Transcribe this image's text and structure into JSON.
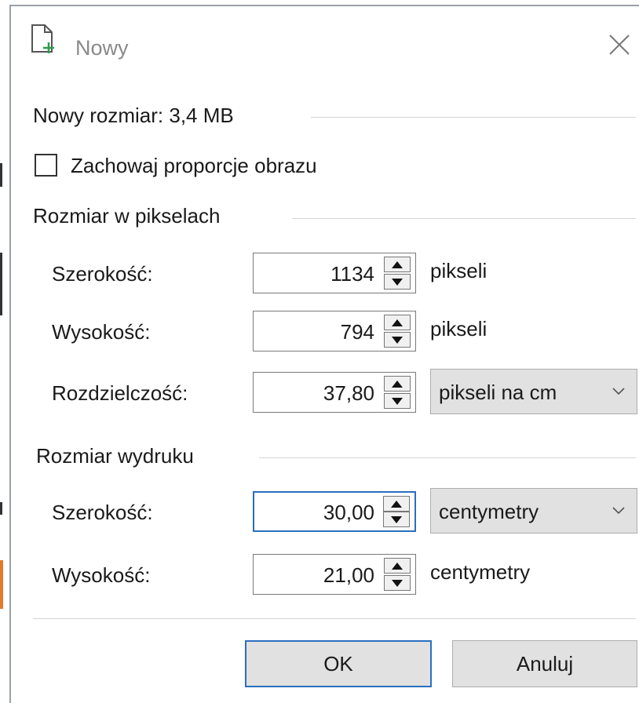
{
  "dialog": {
    "title": "Nowy",
    "new_size_label": "Nowy rozmiar: 3,4 MB",
    "keep_ratio_label": "Zachowaj proporcje obrazu",
    "keep_ratio_checked": false
  },
  "pixel_size": {
    "heading": "Rozmiar w pikselach",
    "width_label": "Szerokość:",
    "width_value": "1134",
    "width_unit": "pikseli",
    "height_label": "Wysokość:",
    "height_value": "794",
    "height_unit": "pikseli",
    "resolution_label": "Rozdzielczość:",
    "resolution_value": "37,80",
    "resolution_unit": "pikseli na cm"
  },
  "print_size": {
    "heading": "Rozmiar wydruku",
    "width_label": "Szerokość:",
    "width_value": "30,00",
    "width_unit": "centymetry",
    "height_label": "Wysokość:",
    "height_value": "21,00",
    "height_unit": "centymetry"
  },
  "buttons": {
    "ok": "OK",
    "cancel": "Anuluj"
  },
  "colors": {
    "focus": "#2a6fbf",
    "button_bg": "#e1e1e1"
  },
  "icons": {
    "title": "new-document-icon",
    "close": "close-icon",
    "spin_up": "arrow-up-icon",
    "spin_down": "arrow-down-icon",
    "dropdown": "chevron-down-icon"
  }
}
